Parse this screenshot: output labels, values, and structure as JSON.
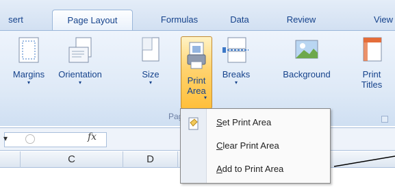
{
  "ribbon_tabs": [
    {
      "label": "sert",
      "active": false
    },
    {
      "label": "Page Layout",
      "active": true
    },
    {
      "label": "Formulas",
      "active": false
    },
    {
      "label": "Data",
      "active": false
    },
    {
      "label": "Review",
      "active": false
    },
    {
      "label": "View",
      "active": false
    }
  ],
  "page_setup": {
    "margins": "Margins",
    "orientation": "Orientation",
    "size": "Size",
    "print_area_line1": "Print",
    "print_area_line2": "Area",
    "breaks": "Breaks",
    "background": "Background",
    "print_titles_line1": "Print",
    "print_titles_line2": "Titles",
    "group_label": "Pag"
  },
  "formula_bar": {
    "fx": "fx"
  },
  "column_headers": [
    "",
    "C",
    "D"
  ],
  "print_area_menu": {
    "set_first": "S",
    "set_rest": "et Print Area",
    "clear_first": "C",
    "clear_rest": "lear Print Area",
    "add_first": "A",
    "add_rest": "dd to Print Area"
  },
  "colors": {
    "ribbon_text": "#15428b",
    "active_button": "#ffd36f",
    "menu_border": "#868686"
  }
}
